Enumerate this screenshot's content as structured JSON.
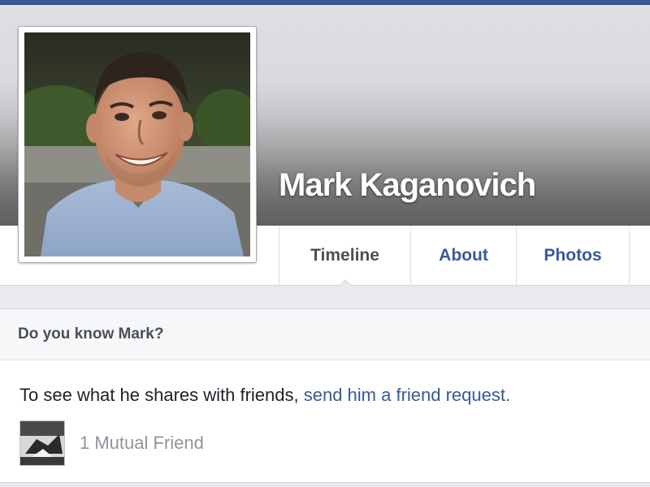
{
  "profile": {
    "name": "Mark Kaganovich"
  },
  "nav": {
    "tabs": [
      {
        "label": "Timeline",
        "active": true
      },
      {
        "label": "About",
        "active": false
      },
      {
        "label": "Photos",
        "active": false
      }
    ]
  },
  "friend_prompt": {
    "title": "Do you know Mark?",
    "text": "To see what he shares with friends, ",
    "link": "send him a friend request.",
    "mutual_count_text": "1 Mutual Friend"
  },
  "colors": {
    "brand_blue": "#3b5998",
    "link_blue": "#3b5998",
    "name_text": "#ffffff"
  },
  "icons": {
    "profile_photo": "profile-photo",
    "mutual_friend_photo": "mutual-friend-avatar"
  }
}
